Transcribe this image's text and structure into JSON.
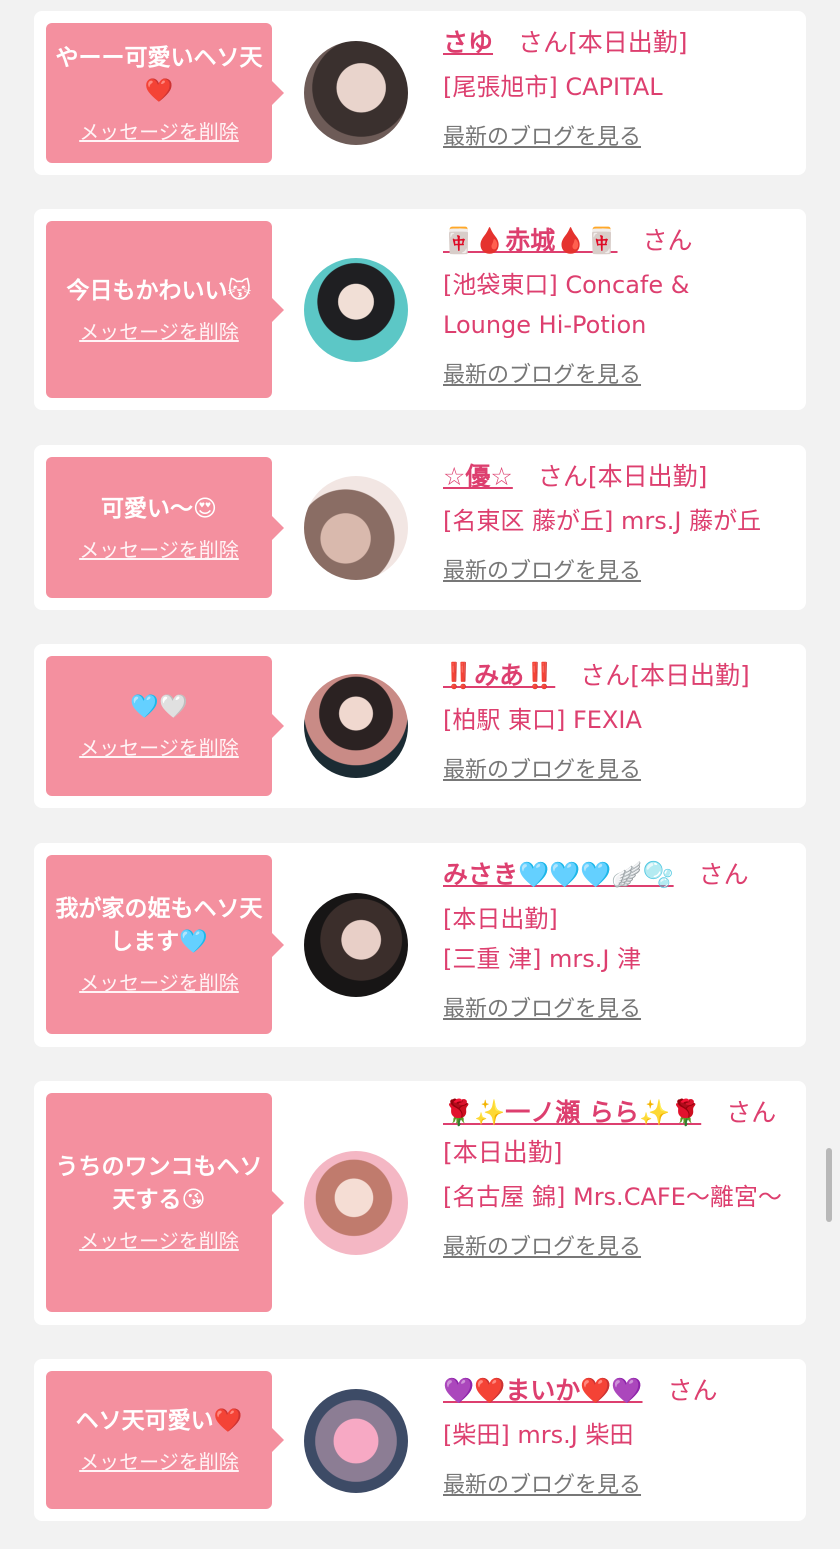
{
  "items": [
    {
      "message": "やーー可愛いヘソ天❤️",
      "delete_label": "メッセージを削除",
      "name": "さゆ",
      "san": "さん",
      "status": "[本日出勤]",
      "shop": "[尾張旭市] CAPITAL",
      "shop2": "",
      "blog_label": "最新のブログを見る"
    },
    {
      "message": "今日もかわいい😽",
      "delete_label": "メッセージを削除",
      "name": "🀄🩸赤城🩸🀄",
      "san": "さん",
      "status": "",
      "shop": "[池袋東口] Concafe &",
      "shop2": "Lounge Hi-Potion",
      "blog_label": "最新のブログを見る"
    },
    {
      "message": "可愛い〜😍",
      "delete_label": "メッセージを削除",
      "name": "☆優☆",
      "san": "さん",
      "status": "[本日出勤]",
      "shop": "[名東区 藤が丘] mrs.J 藤が丘",
      "shop2": "",
      "blog_label": "最新のブログを見る"
    },
    {
      "message": "🩵🤍",
      "delete_label": "メッセージを削除",
      "name": "‼️みあ‼️",
      "san": "さん",
      "status": "[本日出勤]",
      "shop": "[柏駅 東口] FEXIA",
      "shop2": "",
      "blog_label": "最新のブログを見る"
    },
    {
      "message": "我が家の姫もヘソ天します🩵",
      "delete_label": "メッセージを削除",
      "name": "みさき🩵🩵🩵🪽🫧",
      "san": "さん",
      "status": "[本日出勤]",
      "shop": "[三重 津] mrs.J 津",
      "shop2": "",
      "blog_label": "最新のブログを見る"
    },
    {
      "message": "うちのワンコもヘソ天する😘",
      "delete_label": "メッセージを削除",
      "name": "🌹✨一ノ瀬 らら✨🌹",
      "san": "さん",
      "status": "[本日出勤]",
      "shop": "[名古屋 錦] Mrs.CAFE～離宮～",
      "shop2": "",
      "blog_label": "最新のブログを見る"
    },
    {
      "message": "ヘソ天可愛い❤️",
      "delete_label": "メッセージを削除",
      "name": "💜❤️まいか❤️💜",
      "san": "さん",
      "status": "",
      "shop": "[柴田] mrs.J 柴田",
      "shop2": "",
      "blog_label": "最新のブログを見る"
    }
  ]
}
